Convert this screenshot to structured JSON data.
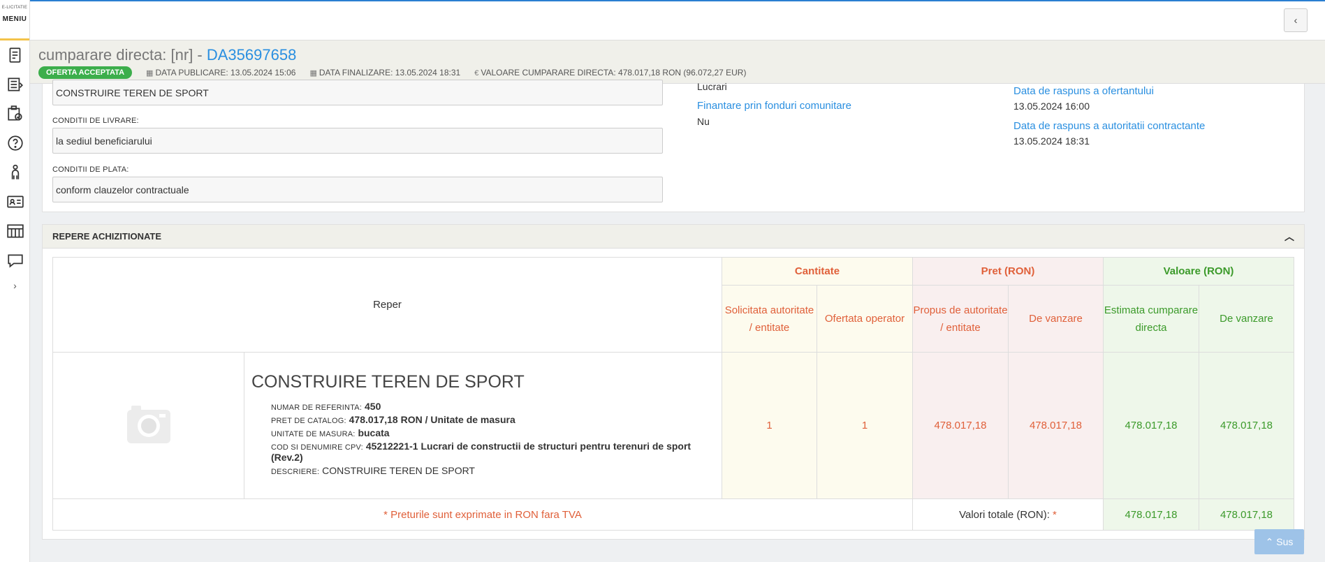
{
  "sidebar": {
    "logo_small": "E-LICITATIE",
    "menu_label": "MENIU",
    "icons": [
      "document-icon",
      "list-icon",
      "checklist-icon",
      "help-icon",
      "user-chart-icon",
      "contact-card-icon",
      "catalog-icon",
      "chat-icon"
    ],
    "expand_label": "›"
  },
  "topbar": {
    "collapse_label": "‹"
  },
  "header": {
    "title_prefix": "cumparare directa: [nr] - ",
    "title_id": "DA35697658",
    "status_badge": "OFERTA ACCEPTATA",
    "data_publicare": "DATA PUBLICARE: 13.05.2024 15:06",
    "data_finalizare": "DATA FINALIZARE: 13.05.2024 18:31",
    "valoare": "VALOARE CUMPARARE DIRECTA: 478.017,18  RON (96.072,27  EUR)"
  },
  "info": {
    "denumire_value": "CONSTRUIRE TEREN DE SPORT",
    "conditii_livrare_label": "CONDITII DE LIVRARE:",
    "conditii_livrare_value": "la sediul beneficiarului",
    "conditii_plata_label": "CONDITII DE PLATA:",
    "conditii_plata_value": "conform clauzelor contractuale",
    "tip_value": "Lucrari",
    "finantare_label": "Finantare prin fonduri comunitare",
    "finantare_value": "Nu",
    "raspuns_ofertant_label": "Data de raspuns a ofertantului",
    "raspuns_ofertant_value": "13.05.2024 16:00",
    "raspuns_autoritate_label": "Data de raspuns a autoritatii contractante",
    "raspuns_autoritate_value": "13.05.2024 18:31"
  },
  "repere": {
    "section_title": "REPERE ACHIZITIONATE",
    "col_reper": "Reper",
    "grp_cantitate": "Cantitate",
    "grp_pret": "Pret (RON)",
    "grp_valoare": "Valoare (RON)",
    "sub_solicitata": "Solicitata autoritate / entitate",
    "sub_ofertata": "Ofertata operator",
    "sub_propus": "Propus de autoritate / entitate",
    "sub_de_vanzare_pret": "De vanzare",
    "sub_estimata": "Estimata cumparare directa",
    "sub_de_vanzare_val": "De vanzare",
    "item": {
      "title": "CONSTRUIRE TEREN DE SPORT",
      "numar_label": "NUMAR DE REFERINTA:",
      "numar_value": "450",
      "pret_label": "PRET DE CATALOG:",
      "pret_value": "478.017,18  RON / Unitate de masura",
      "unitate_label": "UNITATE DE MASURA:",
      "unitate_value": "bucata",
      "cpv_label": "COD SI DENUMIRE CPV:",
      "cpv_value": "45212221-1 Lucrari de constructii de structuri pentru terenuri de sport (Rev.2)",
      "descriere_label": "DESCRIERE:",
      "descriere_value": "CONSTRUIRE TEREN DE SPORT",
      "solicitata": "1",
      "ofertata": "1",
      "propus": "478.017,18",
      "de_vanzare_pret": "478.017,18",
      "estimata": "478.017,18",
      "de_vanzare_val": "478.017,18"
    },
    "footer_note": "* Preturile sunt exprimate in RON fara TVA",
    "totals_label": "Valori totale (RON):",
    "totals_star": "*",
    "total_estimata": "478.017,18",
    "total_de_vanzare": "478.017,18"
  },
  "scroll_top_label": "Sus"
}
